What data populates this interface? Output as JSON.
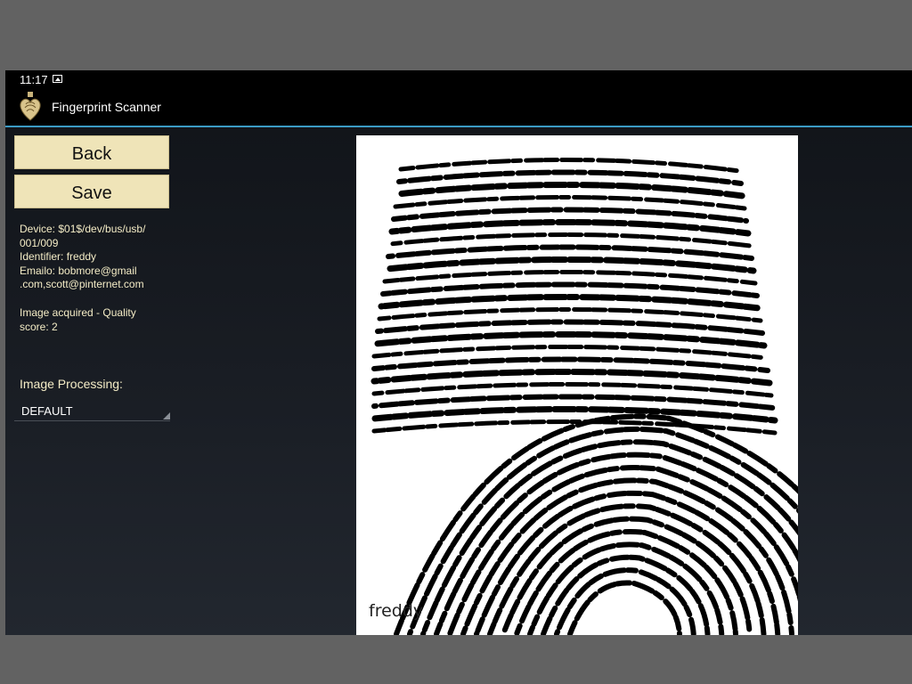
{
  "status_bar": {
    "time": "11:17",
    "icon": "image-notification-icon"
  },
  "action_bar": {
    "title": "Fingerprint Scanner",
    "icon": "fingerprint-heart-pendant-icon"
  },
  "buttons": {
    "back": "Back",
    "save": "Save"
  },
  "info": {
    "device_lines": [
      "Device: $01$/dev/bus/usb/",
      "001/009"
    ],
    "identifier": "Identifier: freddy",
    "email_lines": [
      "Emailo: bobmore@gmail",
      ".com,scott@pinternet.com"
    ],
    "quality_lines": [
      "Image acquired - Quality",
      "score: 2"
    ]
  },
  "image_processing": {
    "label": "Image Processing:",
    "selected": "DEFAULT"
  },
  "fingerprint": {
    "caption": "freddy"
  },
  "colors": {
    "accent": "#3b9ac4",
    "button_bg": "#efe4b8",
    "info_text": "#f4ecc6"
  }
}
